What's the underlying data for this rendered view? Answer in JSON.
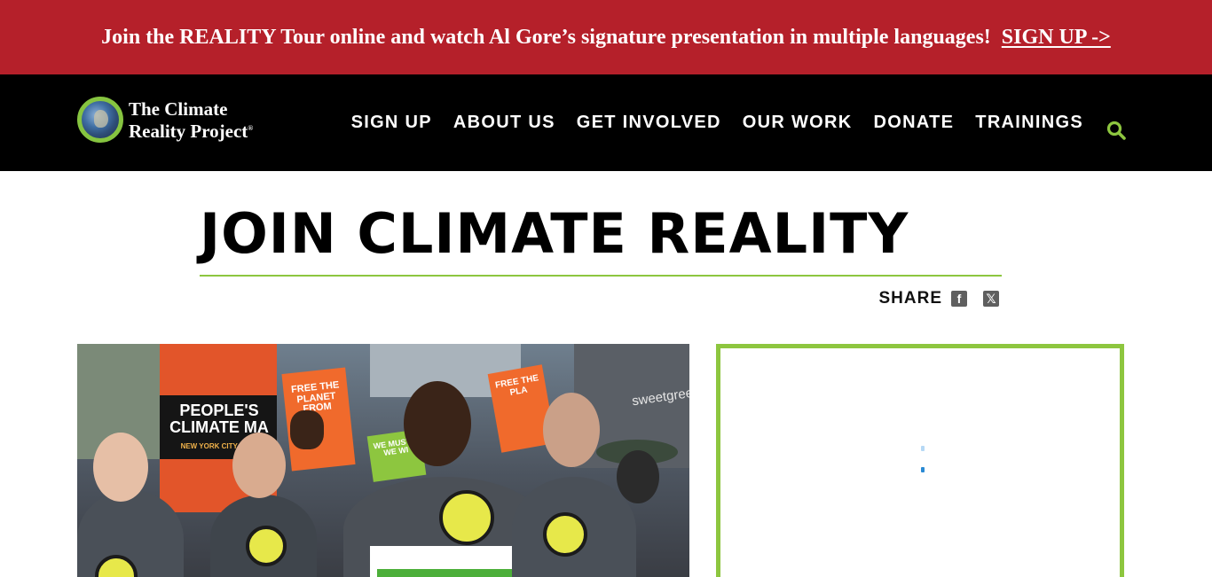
{
  "banner": {
    "text": "Join the REALITY Tour online and watch Al Gore’s signature presentation in multiple languages!",
    "link_label": "SIGN UP ->"
  },
  "header": {
    "logo_line1": "The Climate",
    "logo_line2": "Reality Project",
    "logo_mark": "®",
    "nav": [
      "SIGN UP",
      "ABOUT US",
      "GET INVOLVED",
      "OUR WORK",
      "DONATE",
      "TRAININGS"
    ]
  },
  "page": {
    "title": "JOIN CLIMATE REALITY",
    "share_label": "SHARE",
    "facebook_glyph": "f",
    "x_glyph": "𝕏"
  },
  "hero": {
    "signs": [
      "PEOPLE'S CLIMATE MA",
      "NEW YORK CITY | SEP",
      "FREE THE PLANET FROM",
      "FREE THE PLA",
      "WE MUST... WE WI",
      "sweetgreen"
    ]
  },
  "colors": {
    "banner": "#b5202a",
    "header": "#000000",
    "accent_green": "#8dc63f"
  },
  "icons": {
    "search": "search-icon",
    "facebook": "facebook-icon",
    "x": "x-twitter-icon",
    "logo": "globe-logo-icon"
  }
}
